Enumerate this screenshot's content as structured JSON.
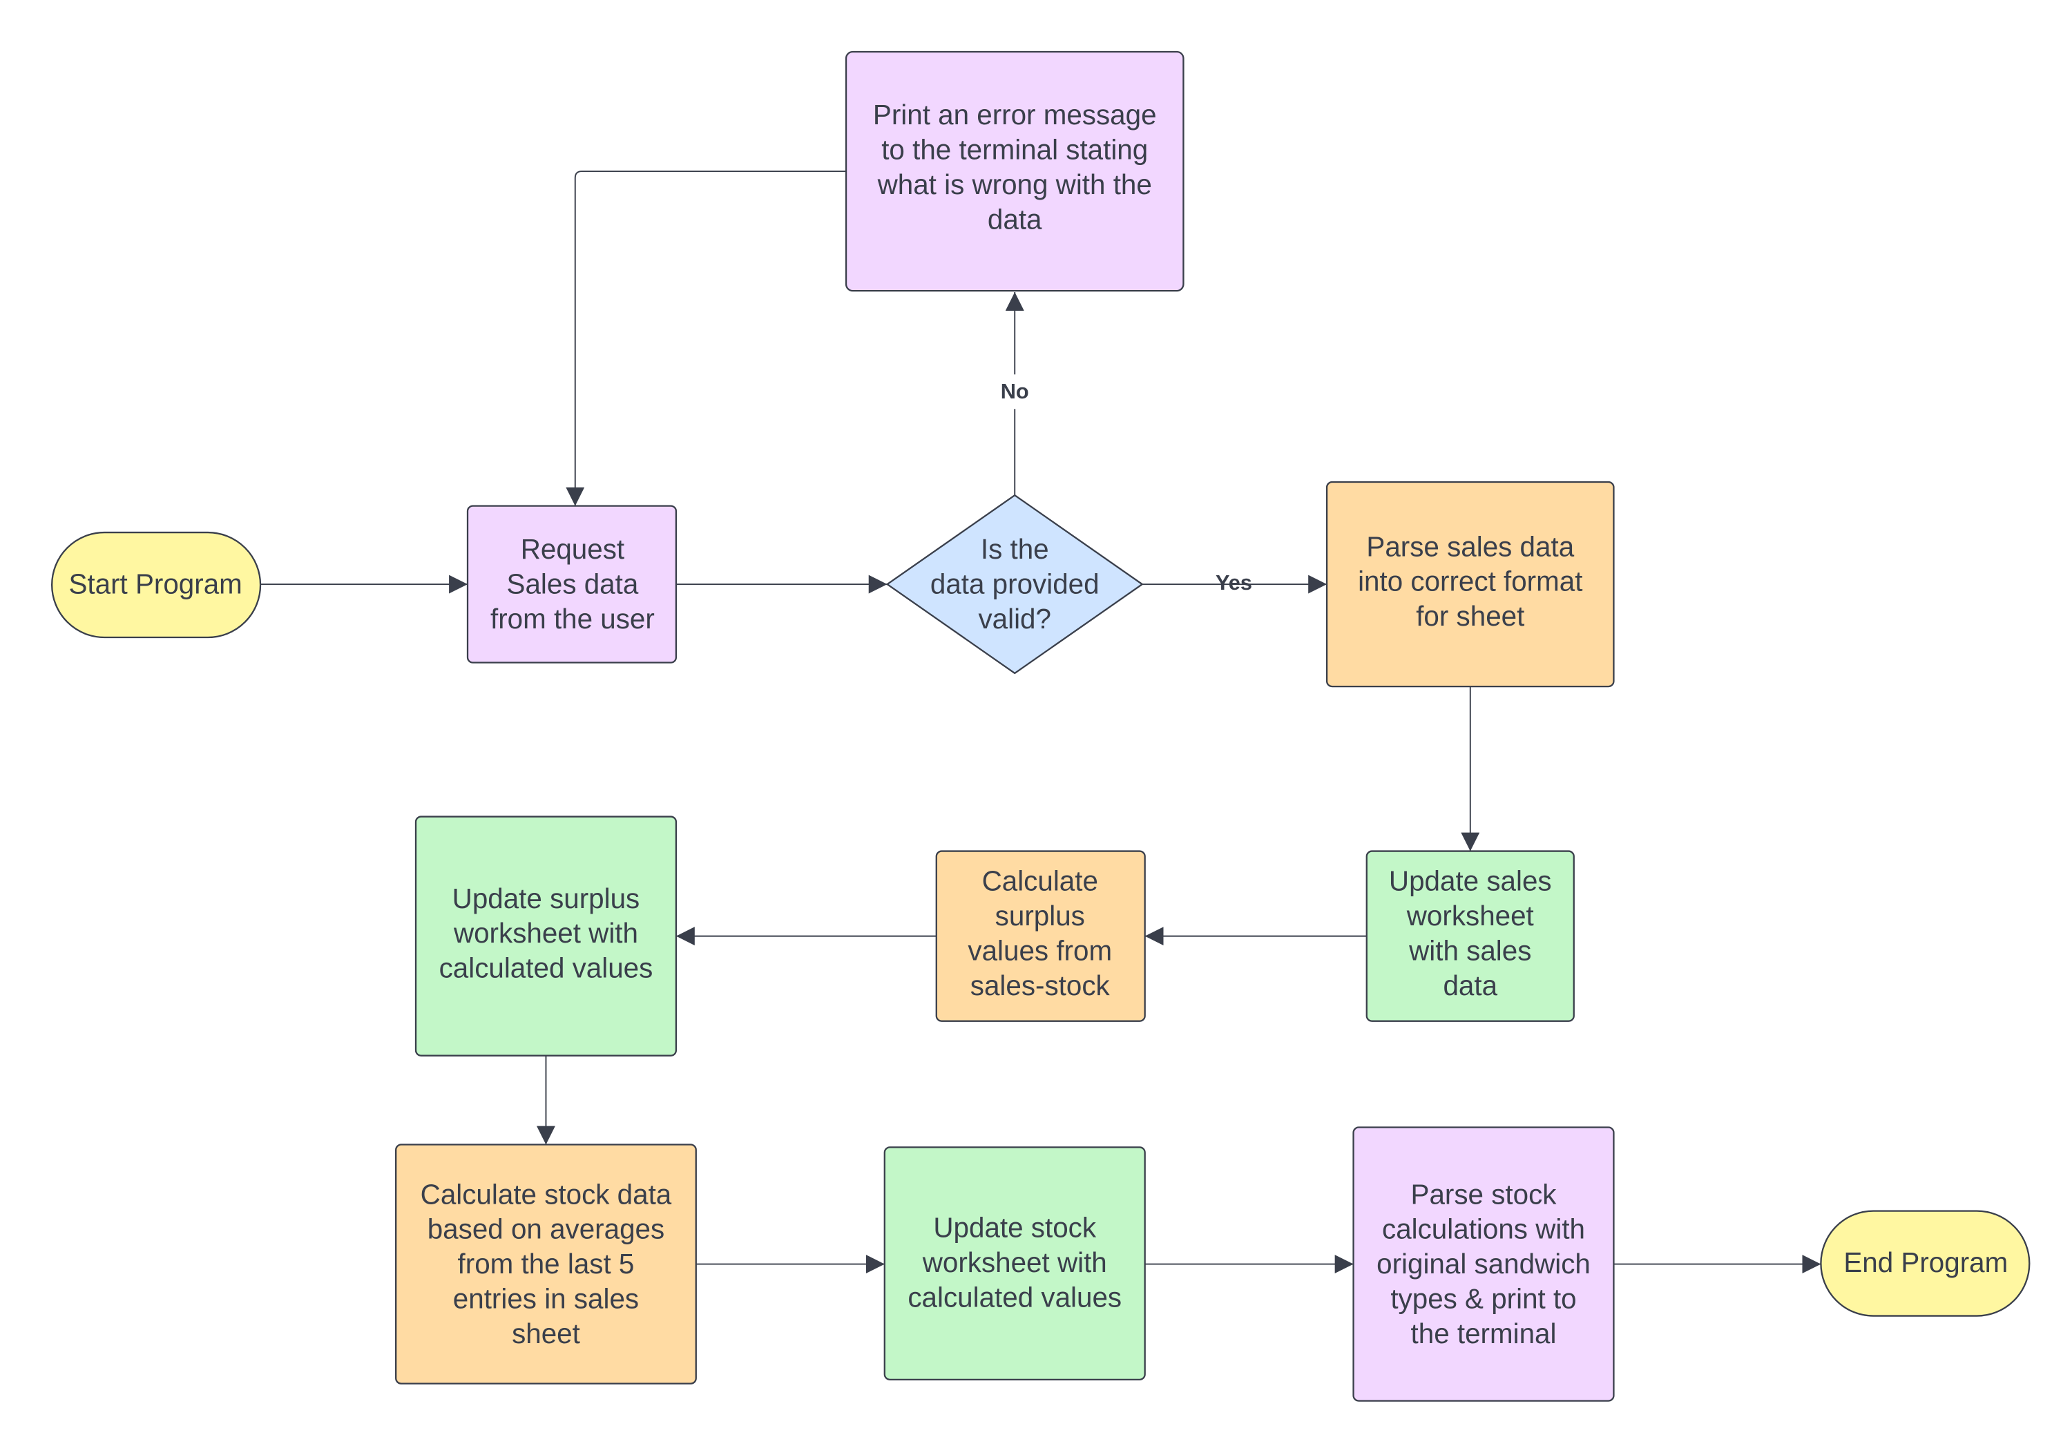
{
  "colors": {
    "terminal": "#FFF7A1",
    "process_purple": "#F2D7FF",
    "decision": "#CFE4FF",
    "process_orange": "#FFDBA3",
    "process_green": "#C3F7C8",
    "stroke": "#3a3f4b"
  },
  "nodes": {
    "start": {
      "lines": [
        "Start Program"
      ]
    },
    "request": {
      "lines": [
        "Request",
        "Sales data",
        "from the user"
      ]
    },
    "decision": {
      "lines": [
        "Is the",
        "data provided",
        "valid?"
      ]
    },
    "error": {
      "lines": [
        "Print an error message",
        "to the terminal stating",
        "what is wrong with the",
        "data"
      ]
    },
    "parse_sales": {
      "lines": [
        "Parse sales data",
        "into correct format",
        "for sheet"
      ]
    },
    "update_sales": {
      "lines": [
        "Update sales",
        "worksheet",
        "with sales",
        "data"
      ]
    },
    "calc_surplus": {
      "lines": [
        "Calculate",
        "surplus",
        "values from",
        "sales-stock"
      ]
    },
    "update_surplus": {
      "lines": [
        "Update surplus",
        "worksheet with",
        "calculated values"
      ]
    },
    "calc_stock": {
      "lines": [
        "Calculate stock data",
        "based on averages",
        "from the last 5",
        "entries in sales",
        "sheet"
      ]
    },
    "update_stock": {
      "lines": [
        "Update stock",
        "worksheet with",
        "calculated values"
      ]
    },
    "parse_stock": {
      "lines": [
        "Parse stock",
        "calculations with",
        "original sandwich",
        "types & print to",
        "the terminal"
      ]
    },
    "end": {
      "lines": [
        "End Program"
      ]
    }
  },
  "edge_labels": {
    "yes": "Yes",
    "no": "No"
  }
}
